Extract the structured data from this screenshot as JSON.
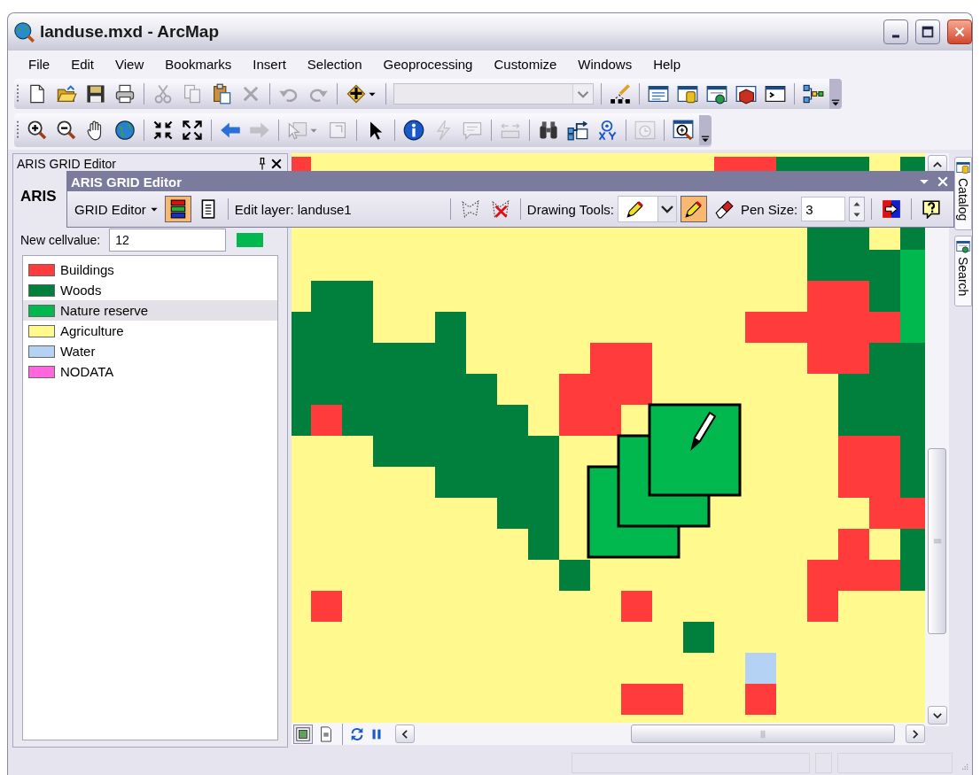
{
  "window": {
    "title": "landuse.mxd - ArcMap"
  },
  "menu": [
    "File",
    "Edit",
    "View",
    "Bookmarks",
    "Insert",
    "Selection",
    "Geoprocessing",
    "Customize",
    "Windows",
    "Help"
  ],
  "toolbars": [
    {
      "items": [
        {
          "kind": "button",
          "disabled": false
        },
        {
          "kind": "button",
          "disabled": false
        },
        {
          "kind": "button",
          "disabled": false
        },
        {
          "kind": "button",
          "disabled": false
        },
        {
          "kind": "separator"
        },
        {
          "kind": "button",
          "disabled": true
        },
        {
          "kind": "button",
          "disabled": true
        },
        {
          "kind": "button",
          "disabled": false
        },
        {
          "kind": "button",
          "disabled": true
        },
        {
          "kind": "separator"
        },
        {
          "kind": "button",
          "disabled": true
        },
        {
          "kind": "button",
          "disabled": true
        },
        {
          "kind": "separator"
        },
        {
          "kind": "split",
          "disabled": false
        },
        {
          "kind": "separator"
        },
        {
          "kind": "combo",
          "disabled": true
        },
        {
          "kind": "separator"
        },
        {
          "kind": "button",
          "disabled": false
        },
        {
          "kind": "separator"
        },
        {
          "kind": "button",
          "disabled": false
        },
        {
          "kind": "button",
          "disabled": false
        },
        {
          "kind": "button",
          "disabled": false
        },
        {
          "kind": "button",
          "disabled": false
        },
        {
          "kind": "button",
          "disabled": false
        },
        {
          "kind": "separator"
        },
        {
          "kind": "button",
          "disabled": false
        }
      ]
    },
    {
      "items": [
        {
          "kind": "button",
          "disabled": false
        },
        {
          "kind": "button",
          "disabled": false
        },
        {
          "kind": "button",
          "disabled": false
        },
        {
          "kind": "button",
          "disabled": false
        },
        {
          "kind": "separator"
        },
        {
          "kind": "button",
          "disabled": false
        },
        {
          "kind": "button",
          "disabled": false
        },
        {
          "kind": "separator"
        },
        {
          "kind": "button",
          "disabled": false
        },
        {
          "kind": "button",
          "disabled": true
        },
        {
          "kind": "separator"
        },
        {
          "kind": "split",
          "disabled": true
        },
        {
          "kind": "button",
          "disabled": true
        },
        {
          "kind": "separator"
        },
        {
          "kind": "button",
          "disabled": false
        },
        {
          "kind": "separator"
        },
        {
          "kind": "button",
          "disabled": false
        },
        {
          "kind": "button",
          "disabled": true
        },
        {
          "kind": "button",
          "disabled": true
        },
        {
          "kind": "separator"
        },
        {
          "kind": "button",
          "disabled": true
        },
        {
          "kind": "separator"
        },
        {
          "kind": "button",
          "disabled": false
        },
        {
          "kind": "button",
          "disabled": false
        },
        {
          "kind": "button",
          "disabled": false
        },
        {
          "kind": "separator"
        },
        {
          "kind": "button",
          "disabled": true
        },
        {
          "kind": "separator"
        },
        {
          "kind": "button",
          "disabled": false
        }
      ]
    }
  ],
  "dock_panel": {
    "title": "ARIS GRID Editor",
    "heading": "ARIS",
    "cellvalue_label": "New cellvalue:",
    "cellvalue": "12",
    "legend": [
      {
        "label": "Buildings",
        "color": "#ff3b3b",
        "selected": false
      },
      {
        "label": "Woods",
        "color": "#00803c",
        "selected": false
      },
      {
        "label": "Nature reserve",
        "color": "#00b84e",
        "selected": true
      },
      {
        "label": "Agriculture",
        "color": "#fff98e",
        "selected": false
      },
      {
        "label": "Water",
        "color": "#b4d2f4",
        "selected": false
      },
      {
        "label": "NODATA",
        "color": "#ff66dd",
        "selected": false
      }
    ]
  },
  "grid_toolbar": {
    "title": "ARIS GRID Editor",
    "items": [
      {
        "kind": "menu",
        "label": "GRID Editor"
      },
      {
        "kind": "button",
        "selected": true
      },
      {
        "kind": "button",
        "selected": false
      },
      {
        "kind": "separator"
      },
      {
        "kind": "label",
        "label": "Edit layer: landuse1"
      },
      {
        "kind": "separator"
      },
      {
        "kind": "button",
        "selected": false
      },
      {
        "kind": "button",
        "selected": false
      },
      {
        "kind": "separator"
      },
      {
        "kind": "label",
        "label": "Drawing Tools:"
      },
      {
        "kind": "combo"
      },
      {
        "kind": "button",
        "selected": true
      },
      {
        "kind": "button",
        "selected": false
      },
      {
        "kind": "label",
        "label": "Pen Size:"
      },
      {
        "kind": "field",
        "value": "3"
      },
      {
        "kind": "spinner"
      },
      {
        "kind": "separator"
      },
      {
        "kind": "button",
        "selected": false
      },
      {
        "kind": "separator"
      },
      {
        "kind": "button",
        "selected": false
      }
    ]
  },
  "side_tabs": [
    {
      "label": "Catalog"
    },
    {
      "label": "Search"
    }
  ]
}
